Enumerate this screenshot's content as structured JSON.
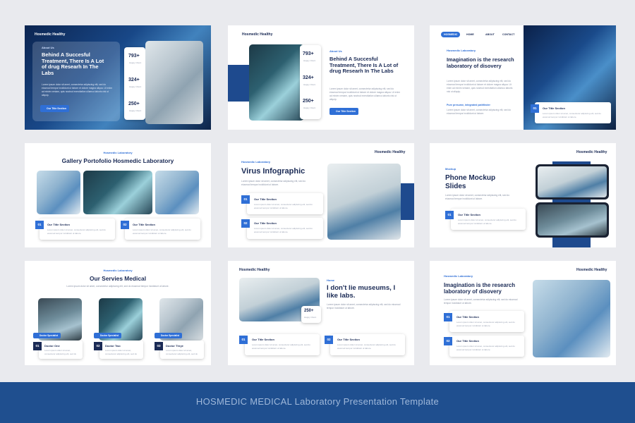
{
  "brand": "Hosmedic Healthy",
  "common": {
    "about_us": "About Us",
    "laboratory": "Hosmedic Laboratory",
    "lorem": "Lorem ipsum dolor sit amet, consectetur adipiscing elit, sed do eiusmod tempor incididunt ut labore et dolore magna aliqua. Ut enim ad minim veniam, quis nostrud exercitation ullamco laboris nisi ut aliquip.",
    "lorem_short": "Lorem ipsum dolor sit amet, consectetur adipiscing elit, sed do eiusmod tempor incididunt ut labore.",
    "section_title": "Our Title Section",
    "button": "Our Title Section",
    "happy_clients": "Happy Client",
    "n01": "01",
    "n02": "02",
    "n03": "03"
  },
  "slide1": {
    "title": "Behind A Succesful Treatment, There Is A Lot of drug Researh In The Labs",
    "stats": [
      {
        "value": "793+",
        "label": "Happy Client"
      },
      {
        "value": "324+",
        "label": "Happy Client"
      },
      {
        "value": "250+",
        "label": "Happy Client"
      }
    ]
  },
  "slide2": {
    "title": "Behind A Succesful Treatment, There Is A Lot of drug Researh In The Labs",
    "stats": [
      {
        "value": "793+",
        "label": "Happy Client"
      },
      {
        "value": "324+",
        "label": "Happy Client"
      },
      {
        "value": "250+",
        "label": "Happy Client"
      }
    ]
  },
  "slide3": {
    "nav": [
      "HOSMEDIC",
      "HOME",
      "ABOUT",
      "CONTACT"
    ],
    "title": "Imagination is the research laboratory of disovery",
    "link": "Pure presume, integrated pathfinder"
  },
  "slide4": {
    "title": "Gallery Portofolio Hosmedic Laboratory"
  },
  "slide5": {
    "title": "Virus Infographic"
  },
  "slide6": {
    "tag": "Mockup",
    "title": "Phone Mockup Slides"
  },
  "slide7": {
    "title": "Our Servies Medical",
    "doctors": [
      "Doctor One",
      "Doctor Two",
      "Doctor Thrye"
    ],
    "badge": "Doctor Specialist"
  },
  "slide8": {
    "tag": "Home",
    "title": "I don't lie museums, I like labs.",
    "stat": "250+",
    "stat_label": "Happy Client"
  },
  "slide9": {
    "title": "Imagination is the research laboratory of disovery"
  },
  "footer": {
    "caption": "HOSMEDIC MEDICAL Laboratory Presentation Template"
  },
  "colors": {
    "accent": "#2f6fd6",
    "navy": "#1a2a55",
    "footer_bg": "#1f4f8f",
    "page_bg": "#e9eaee"
  }
}
